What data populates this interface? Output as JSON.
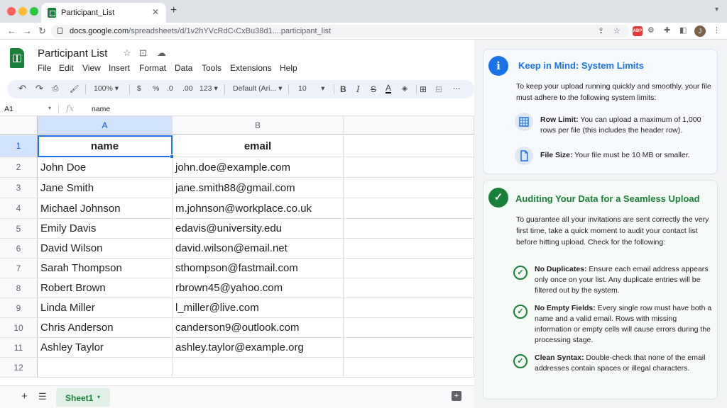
{
  "browser": {
    "tab_title": "Participant_List",
    "url_host": "docs.google.com",
    "url_path": "/spreadsheets/d/1v2hYVcRdC‹CxBu38d1....participant_list",
    "profile_initial": "J",
    "abp_label": "ABP"
  },
  "sheet": {
    "title": "Participant List",
    "menu": [
      "File",
      "Edit",
      "View",
      "Insert",
      "Format",
      "Data",
      "Tools",
      "Extensions",
      "Help"
    ],
    "toolbar": {
      "zoom": "100%",
      "currency": "$",
      "percent": "%",
      "dec_decrease": ".0",
      "dec_increase": ".00",
      "number_format": "123",
      "font": "Default (Ari...",
      "font_size": "10"
    },
    "name_box": "A1",
    "fx_label": "fx",
    "formula_value": "name",
    "columns": [
      "A",
      "B"
    ],
    "rows": [
      {
        "num": "1",
        "name": "name",
        "email": "email"
      },
      {
        "num": "2",
        "name": "John Doe",
        "email": "john.doe@example.com"
      },
      {
        "num": "3",
        "name": "Jane Smith",
        "email": "jane.smith88@gmail.com"
      },
      {
        "num": "4",
        "name": "Michael Johnson",
        "email": "m.johnson@workplace.co.uk"
      },
      {
        "num": "5",
        "name": "Emily Davis",
        "email": "edavis@university.edu"
      },
      {
        "num": "6",
        "name": "David Wilson",
        "email": "david.wilson@email.net"
      },
      {
        "num": "7",
        "name": "Sarah Thompson",
        "email": "sthompson@fastmail.com"
      },
      {
        "num": "8",
        "name": "Robert Brown",
        "email": "rbrown45@yahoo.com"
      },
      {
        "num": "9",
        "name": "Linda Miller",
        "email": "l_miller@live.com"
      },
      {
        "num": "10",
        "name": "Chris Anderson",
        "email": "canderson9@outlook.com"
      },
      {
        "num": "11",
        "name": "Ashley Taylor",
        "email": "ashley.taylor@example.org"
      },
      {
        "num": "12",
        "name": "",
        "email": ""
      }
    ],
    "sheet_tab": "Sheet1"
  },
  "panel": {
    "card1": {
      "title": "Keep in Mind: System Limits",
      "intro": "To keep your upload running quickly and smoothly, your file must adhere to the following system limits:",
      "items": [
        {
          "label": "Row Limit:",
          "text": " You can upload a maximum of 1,000 rows per file (this includes the header row)."
        },
        {
          "label": "File Size:",
          "text": " Your file must be 10 MB or smaller."
        }
      ]
    },
    "card2": {
      "title": "Auditing Your Data for a Seamless Upload",
      "intro": "To guarantee all your invitations are sent correctly the very first time, take a quick moment to audit your contact list before hitting upload. Check for the following:",
      "items": [
        {
          "label": "No Duplicates:",
          "text": " Ensure each email address appears only once on your list. Any duplicate entries will be filtered out by the system."
        },
        {
          "label": "No Empty Fields:",
          "text": " Every single row must have both a name and a valid email. Rows with missing information or empty cells will cause errors during the processing stage."
        },
        {
          "label": "Clean Syntax:",
          "text": " Double-check that none of the email addresses contain spaces or illegal characters."
        }
      ]
    }
  },
  "colors": {
    "accent_blue": "#1a73e8",
    "sheets_green": "#188038"
  }
}
